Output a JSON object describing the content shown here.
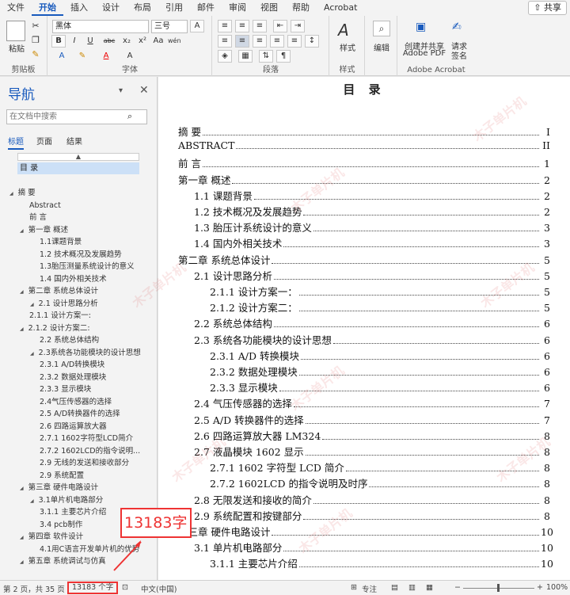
{
  "menubar": {
    "tabs": [
      "文件",
      "开始",
      "插入",
      "设计",
      "布局",
      "引用",
      "邮件",
      "审阅",
      "视图",
      "帮助",
      "Acrobat"
    ],
    "share": "共享"
  },
  "ribbon": {
    "clipboard": {
      "paste": "粘贴",
      "label": "剪贴板"
    },
    "font": {
      "name": "黑体",
      "size": "三号",
      "label": "字体",
      "aa_up": "A",
      "aa_down": "A",
      "aa_btn": "Aa",
      "wen": "wén",
      "bold": "B",
      "italic": "I",
      "underline": "U",
      "strike": "abc",
      "sub": "x₂",
      "sup": "x²",
      "a_color": "A",
      "a_char": "A",
      "box_a": "A"
    },
    "paragraph": {
      "label": "段落"
    },
    "styles": {
      "label": "样式",
      "style_btn": "样式"
    },
    "edit": {
      "label": "编辑"
    },
    "acrobat": {
      "create": "创建并共享",
      "create2": "Adobe PDF",
      "req": "请求",
      "sign": "签名",
      "label": "Adobe Acrobat"
    }
  },
  "nav": {
    "title": "导航",
    "search_placeholder": "在文档中搜索",
    "tabs": [
      "标题",
      "页面",
      "结果"
    ],
    "selected": "目 录",
    "items": [
      {
        "text": "摘 要",
        "level": 0,
        "caret": "◢"
      },
      {
        "text": "Abstract",
        "level": 1,
        "caret": ""
      },
      {
        "text": "前 言",
        "level": 1,
        "caret": ""
      },
      {
        "text": "第一章  概述",
        "level": 1,
        "caret": "◢"
      },
      {
        "text": "1.1课题背景",
        "level": 2,
        "caret": ""
      },
      {
        "text": "1.2 技术概况及发展趋势",
        "level": 2,
        "caret": ""
      },
      {
        "text": "1.3胎压测量系统设计的意义",
        "level": 2,
        "caret": ""
      },
      {
        "text": "1.4 国内外相关技术",
        "level": 2,
        "caret": ""
      },
      {
        "text": "第二章  系统总体设计",
        "level": 1,
        "caret": "◢"
      },
      {
        "text": "2.1 设计思路分析",
        "level": 2,
        "caret": "◢"
      },
      {
        "text": "2.1.1 设计方案一:",
        "level": 1,
        "caret": ""
      },
      {
        "text": "2.1.2 设计方案二:",
        "level": 1,
        "caret": "◢"
      },
      {
        "text": "2.2 系统总体结构",
        "level": 2,
        "caret": ""
      },
      {
        "text": "2.3系统各功能模块的设计思想",
        "level": 2,
        "caret": "◢"
      },
      {
        "text": "2.3.1 A/D转换模块",
        "level": 2,
        "caret": ""
      },
      {
        "text": "2.3.2 数据处理模块",
        "level": 2,
        "caret": ""
      },
      {
        "text": "2.3.3 显示模块",
        "level": 2,
        "caret": ""
      },
      {
        "text": "2.4气压传感器的选择",
        "level": 2,
        "caret": ""
      },
      {
        "text": "2.5 A/D转换器件的选择",
        "level": 2,
        "caret": ""
      },
      {
        "text": "2.6 四路运算放大器",
        "level": 2,
        "caret": ""
      },
      {
        "text": "2.7.1   1602字符型LCD简介",
        "level": 2,
        "caret": ""
      },
      {
        "text": "2.7.2   1602LCD的指令说明...",
        "level": 2,
        "caret": ""
      },
      {
        "text": "2.9 无线的发送和接收部分",
        "level": 2,
        "caret": ""
      },
      {
        "text": "2.9 系统配置",
        "level": 2,
        "caret": ""
      },
      {
        "text": "第三章  硬件电路设计",
        "level": 1,
        "caret": "◢"
      },
      {
        "text": "3.1单片机电路部分",
        "level": 2,
        "caret": "◢"
      },
      {
        "text": "3.1.1 主要芯片介绍",
        "level": 2,
        "caret": ""
      },
      {
        "text": "3.4 pcb制作",
        "level": 2,
        "caret": ""
      },
      {
        "text": "第四章 软件设计",
        "level": 1,
        "caret": "◢"
      },
      {
        "text": "4.1用C语言开发单片机的优势",
        "level": 2,
        "caret": ""
      },
      {
        "text": "第五章  系统调试与仿真",
        "level": 1,
        "caret": "◢"
      }
    ]
  },
  "document": {
    "title": "目 录",
    "toc": [
      {
        "text": "摘    要",
        "page": "I",
        "indent": 0
      },
      {
        "text": "ABSTRACT",
        "page": "II",
        "indent": 0
      },
      {
        "text": "前 言",
        "page": "1",
        "indent": 0
      },
      {
        "text": "第一章    概述",
        "page": "2",
        "indent": 0
      },
      {
        "text": "1.1 课题背景",
        "page": "2",
        "indent": 1
      },
      {
        "text": "1.2  技术概况及发展趋势",
        "page": "2",
        "indent": 1
      },
      {
        "text": "1.3 胎压计系统设计的意义",
        "page": "3",
        "indent": 1
      },
      {
        "text": "1.4 国内外相关技术",
        "page": "3",
        "indent": 1
      },
      {
        "text": "第二章    系统总体设计",
        "page": "5",
        "indent": 0
      },
      {
        "text": "2.1 设计思路分析",
        "page": "5",
        "indent": 1
      },
      {
        "text": "2.1.1  设计方案一：",
        "page": "5",
        "indent": 2
      },
      {
        "text": "2.1.2  设计方案二：",
        "page": "5",
        "indent": 2
      },
      {
        "text": "2.2 系统总体结构",
        "page": "6",
        "indent": 1
      },
      {
        "text": "2.3 系统各功能模块的设计思想",
        "page": "6",
        "indent": 1
      },
      {
        "text": "2.3.1  A/D 转换模块",
        "page": "6",
        "indent": 2
      },
      {
        "text": "2.3.2  数据处理模块",
        "page": "6",
        "indent": 2
      },
      {
        "text": "2.3.3  显示模块",
        "page": "6",
        "indent": 2
      },
      {
        "text": "2.4 气压传感器的选择",
        "page": "7",
        "indent": 1
      },
      {
        "text": "2.5 A/D 转换器件的选择",
        "page": "7",
        "indent": 1
      },
      {
        "text": "2.6 四路运算放大器 LM324",
        "page": "8",
        "indent": 1
      },
      {
        "text": "2.7 液晶模块 1602 显示",
        "page": "8",
        "indent": 1
      },
      {
        "text": "2.7.1  1602 字符型 LCD 简介",
        "page": "8",
        "indent": 2
      },
      {
        "text": "2.7.2  1602LCD 的指令说明及时序",
        "page": "8",
        "indent": 2
      },
      {
        "text": "2.8 无限发送和接收的简介",
        "page": "8",
        "indent": 1
      },
      {
        "text": "2.9 系统配置和按键部分",
        "page": "8",
        "indent": 1
      },
      {
        "text": "第三章    硬件电路设计",
        "page": "10",
        "indent": 0
      },
      {
        "text": "3.1 单片机电路部分",
        "page": "10",
        "indent": 1
      },
      {
        "text": "3.1.1  主要芯片介绍",
        "page": "10",
        "indent": 2
      }
    ]
  },
  "callout": {
    "text": "13183字"
  },
  "watermark": {
    "text": "木子单片机"
  },
  "status": {
    "page": "第 2 页，共 35 页",
    "words": "13183 个字",
    "lang": "中文(中国)",
    "focus": "专注",
    "zoom_minus": "−",
    "zoom_plus": "+",
    "zoom": "100%"
  },
  "colors": {
    "accent": "#185abd",
    "highlight": "#e33333"
  }
}
